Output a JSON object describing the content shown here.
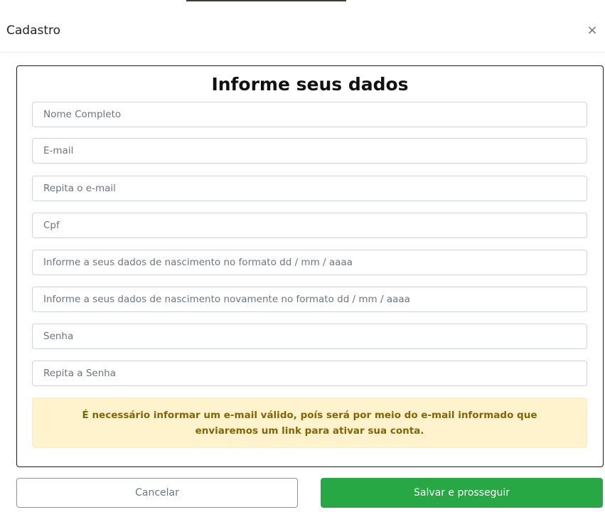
{
  "modal": {
    "title": "Cadastro",
    "close_symbol": "×",
    "close_icon": "close-icon"
  },
  "form": {
    "heading": "Informe seus dados",
    "fields": {
      "full_name": {
        "placeholder": "Nome Completo",
        "value": ""
      },
      "email": {
        "placeholder": "E-mail",
        "value": ""
      },
      "email_confirm": {
        "placeholder": "Repita o e-mail",
        "value": ""
      },
      "cpf": {
        "placeholder": "Cpf",
        "value": ""
      },
      "birthdate": {
        "placeholder": "Informe a seus dados de nascimento no formato dd / mm / aaaa",
        "value": ""
      },
      "birthdate_confirm": {
        "placeholder": "Informe a seus dados de nascimento novamente no formato dd / mm / aaaa",
        "value": ""
      },
      "password": {
        "placeholder": "Senha",
        "value": ""
      },
      "password_confirm": {
        "placeholder": "Repita a Senha",
        "value": ""
      }
    },
    "notice": "É necessário informar um e-mail válido, poís será por meio do e-mail informado que enviaremos um link para ativar sua conta."
  },
  "footer": {
    "cancel_label": "Cancelar",
    "save_label": "Salvar e prosseguir"
  },
  "colors": {
    "primary_success": "#28a745",
    "alert_bg": "#fff3cd",
    "alert_text": "#856404",
    "border": "#ced4da"
  }
}
